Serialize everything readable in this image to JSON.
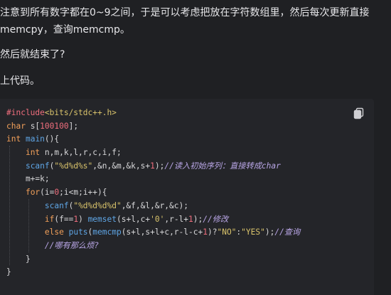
{
  "article": {
    "p1_line1": "注意到所有数字都在0~9之间，于是可以考虑把放在字符数组里，然后每次更新直接",
    "p1_line2": "memcpy，查询memcmp。",
    "p2": "然后就结束了?",
    "p3": "上代码。"
  },
  "code": {
    "copy_icon": "copy-icon",
    "language": "cpp",
    "lines": [
      [
        {
          "t": "#include",
          "c": "pp"
        },
        {
          "t": "<bits/stdc++.h>",
          "c": "str"
        }
      ],
      [
        {
          "t": "char",
          "c": "kw"
        },
        {
          "t": " s[",
          "c": ""
        },
        {
          "t": "100100",
          "c": "num"
        },
        {
          "t": "];",
          "c": ""
        }
      ],
      [
        {
          "t": "int",
          "c": "kw"
        },
        {
          "t": " ",
          "c": ""
        },
        {
          "t": "main",
          "c": "fn"
        },
        {
          "t": "(){",
          "c": ""
        }
      ],
      [
        {
          "t": "    ",
          "c": ""
        },
        {
          "t": "int",
          "c": "kw"
        },
        {
          "t": " n,m,k,l,r,c,i,f;",
          "c": ""
        }
      ],
      [
        {
          "t": "    ",
          "c": ""
        },
        {
          "t": "scanf",
          "c": "fn"
        },
        {
          "t": "(",
          "c": ""
        },
        {
          "t": "\"%d%d%s\"",
          "c": "str"
        },
        {
          "t": ",&n,&m,&k,s+",
          "c": ""
        },
        {
          "t": "1",
          "c": "num"
        },
        {
          "t": ");",
          "c": ""
        },
        {
          "t": "//读入初始序列：直接转成char",
          "c": "cm"
        }
      ],
      [
        {
          "t": "    m+=k;",
          "c": ""
        }
      ],
      [
        {
          "t": "    ",
          "c": ""
        },
        {
          "t": "for",
          "c": "kw"
        },
        {
          "t": "(i=",
          "c": ""
        },
        {
          "t": "0",
          "c": "num"
        },
        {
          "t": ";i<m;i++){",
          "c": ""
        }
      ],
      [
        {
          "t": "        ",
          "c": ""
        },
        {
          "t": "scanf",
          "c": "fn"
        },
        {
          "t": "(",
          "c": ""
        },
        {
          "t": "\"%d%d%d%d\"",
          "c": "str"
        },
        {
          "t": ",&f,&l,&r,&c);",
          "c": ""
        }
      ],
      [
        {
          "t": "        ",
          "c": ""
        },
        {
          "t": "if",
          "c": "kw"
        },
        {
          "t": "(f==",
          "c": ""
        },
        {
          "t": "1",
          "c": "num"
        },
        {
          "t": ") ",
          "c": ""
        },
        {
          "t": "memset",
          "c": "fn"
        },
        {
          "t": "(s+l,c+",
          "c": ""
        },
        {
          "t": "'0'",
          "c": "str"
        },
        {
          "t": ",r-l+",
          "c": ""
        },
        {
          "t": "1",
          "c": "num"
        },
        {
          "t": ");",
          "c": ""
        },
        {
          "t": "//修改",
          "c": "cm"
        }
      ],
      [
        {
          "t": "        ",
          "c": ""
        },
        {
          "t": "else",
          "c": "kw"
        },
        {
          "t": " ",
          "c": ""
        },
        {
          "t": "puts",
          "c": "fn"
        },
        {
          "t": "(",
          "c": ""
        },
        {
          "t": "memcmp",
          "c": "fn"
        },
        {
          "t": "(s+l,s+l+c,r-l-c+",
          "c": ""
        },
        {
          "t": "1",
          "c": "num"
        },
        {
          "t": ")?",
          "c": ""
        },
        {
          "t": "\"NO\"",
          "c": "str"
        },
        {
          "t": ":",
          "c": ""
        },
        {
          "t": "\"YES\"",
          "c": "str"
        },
        {
          "t": ");",
          "c": ""
        },
        {
          "t": "//查询",
          "c": "cm"
        }
      ],
      [
        {
          "t": "        ",
          "c": ""
        },
        {
          "t": "//哪有那么烦?",
          "c": "cm"
        }
      ],
      [
        {
          "t": "    }",
          "c": ""
        }
      ],
      [
        {
          "t": "}",
          "c": ""
        }
      ]
    ]
  }
}
